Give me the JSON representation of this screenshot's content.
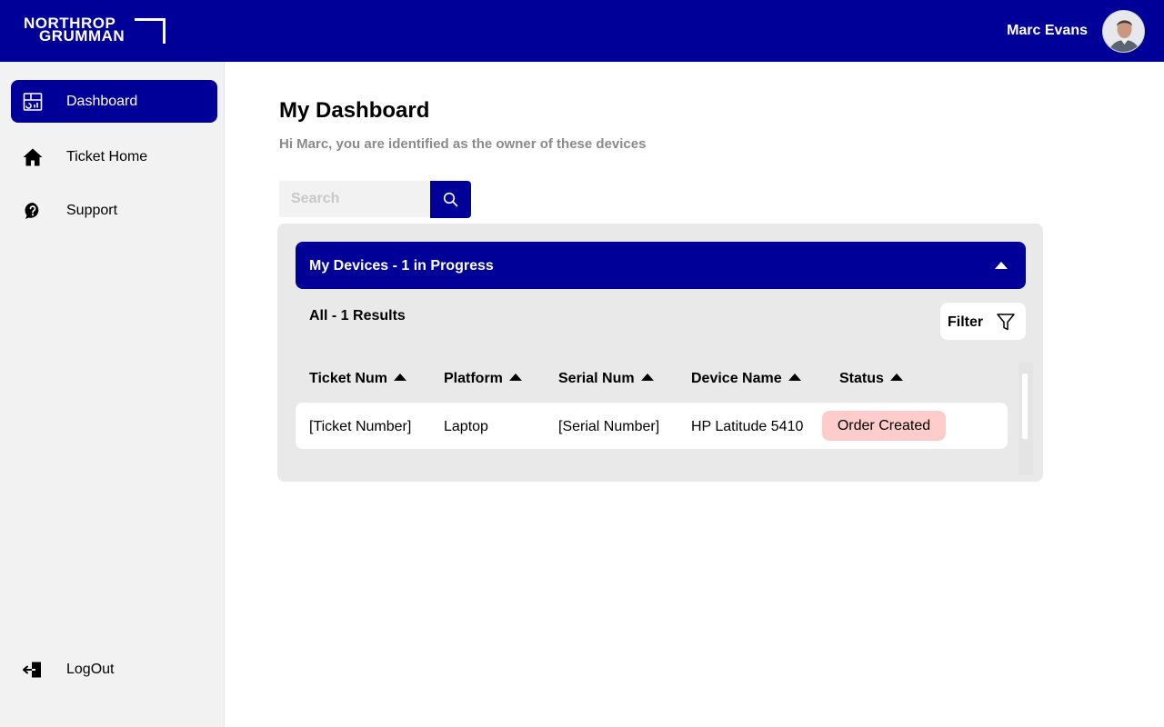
{
  "header": {
    "logo_line1": "NORTHROP",
    "logo_line2": "GRUMMAN",
    "user_name": "Marc Evans"
  },
  "sidebar": {
    "items": [
      {
        "label": "Dashboard",
        "icon": "dashboard-icon",
        "active": true
      },
      {
        "label": "Ticket Home",
        "icon": "home-icon",
        "active": false
      },
      {
        "label": "Support",
        "icon": "help-chat-icon",
        "active": false
      }
    ],
    "logout_label": "LogOut"
  },
  "main": {
    "title": "My Dashboard",
    "subtitle": "Hi Marc, you are identified as the owner of these devices",
    "search": {
      "placeholder": "Search",
      "value": ""
    },
    "devices": {
      "section_title": "My Devices - 1 in Progress",
      "results_label": "All - 1 Results",
      "filter_label": "Filter",
      "columns": [
        "Ticket Num",
        "Platform",
        "Serial Num",
        "Device Name",
        "Status"
      ],
      "rows": [
        {
          "ticket": "[Ticket Number]",
          "platform": "Laptop",
          "serial": "[Serial Number]",
          "device": "HP Latitude 5410",
          "status": "Order Created"
        }
      ]
    }
  },
  "colors": {
    "brand": "#000099",
    "sidebar_bg": "#f2f2f2",
    "panel_bg": "#e9e9e9",
    "status_badge": "#ffcccc",
    "subtitle_text": "#8a8a8a"
  }
}
